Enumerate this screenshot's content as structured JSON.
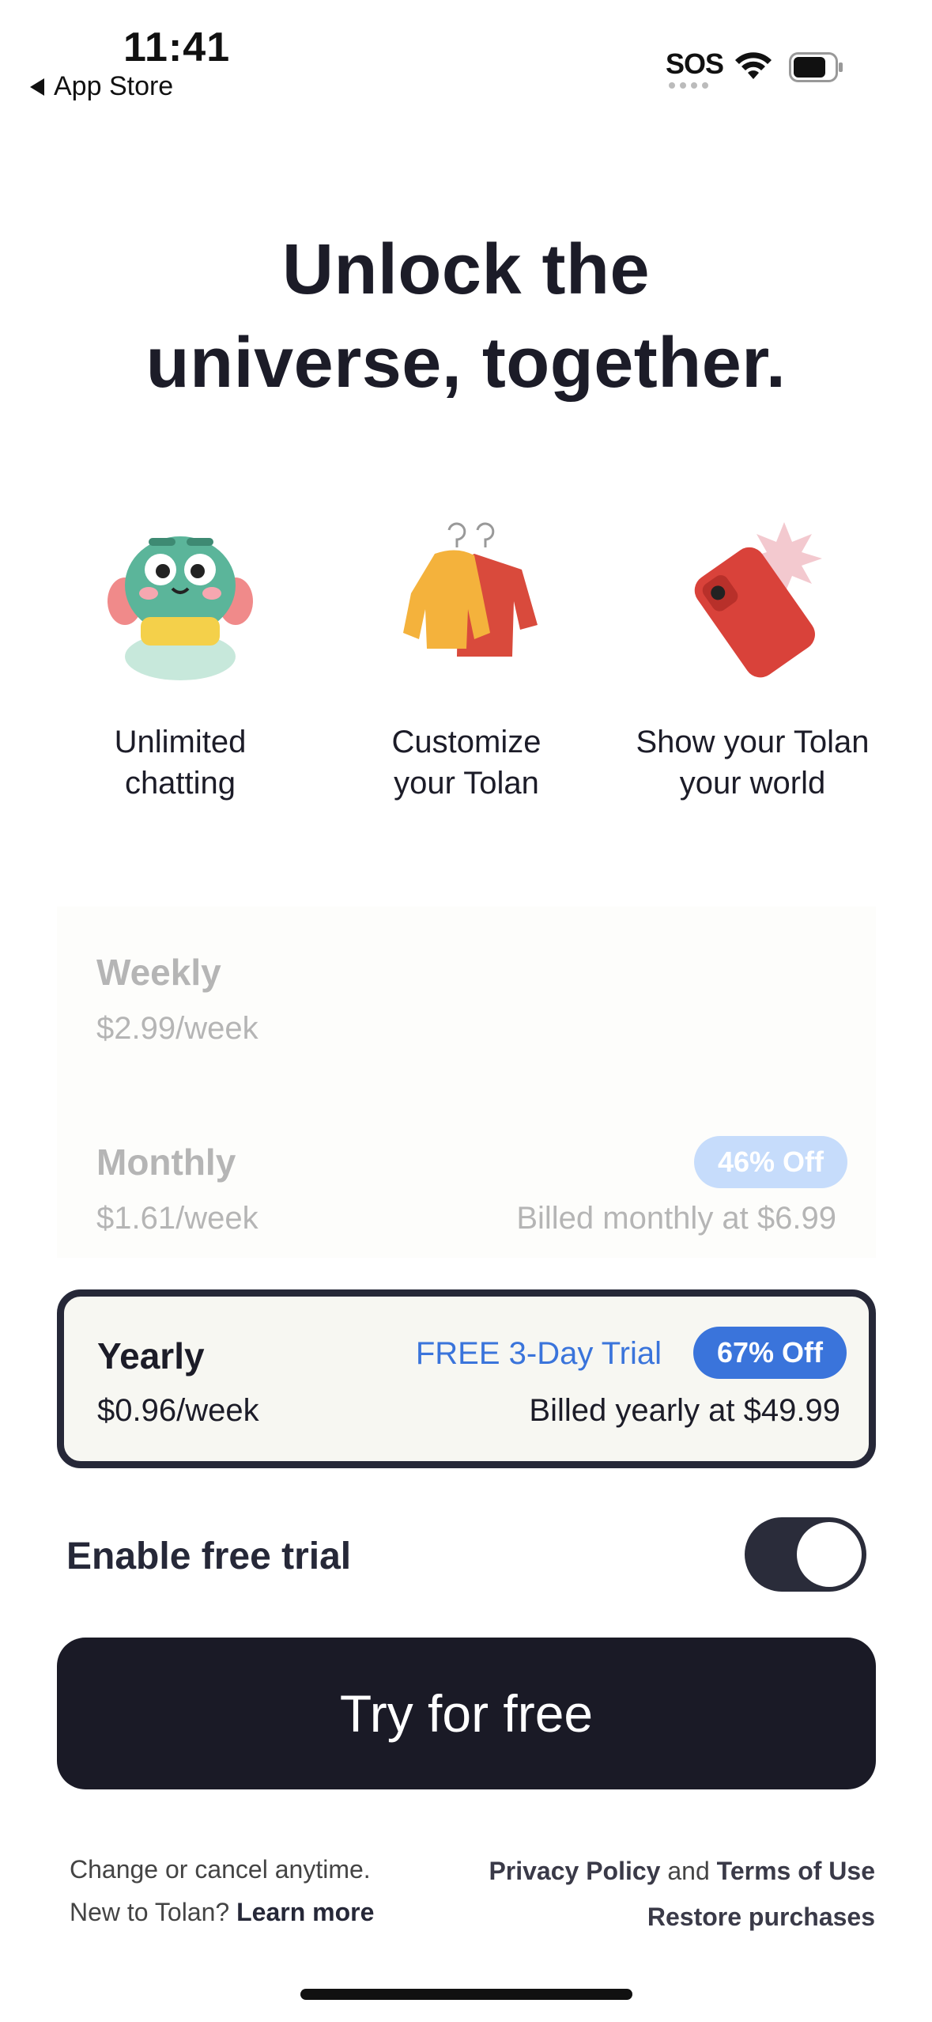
{
  "status_bar": {
    "time": "11:41",
    "back_label": "App Store",
    "sos": "SOS"
  },
  "headline": {
    "line1": "Unlock the",
    "line2": "universe, together."
  },
  "features": [
    {
      "line1": "Unlimited",
      "line2": "chatting",
      "icon": "tolan-character-icon"
    },
    {
      "line1": "Customize",
      "line2": "your Tolan",
      "icon": "clothes-hanger-icon"
    },
    {
      "line1": "Show your Tolan",
      "line2": "your world",
      "icon": "phone-camera-icon"
    }
  ],
  "plans": {
    "weekly": {
      "name": "Weekly",
      "price": "$2.99/week"
    },
    "monthly": {
      "name": "Monthly",
      "price": "$1.61/week",
      "badge": "46% Off",
      "billed": "Billed monthly at $6.99"
    },
    "yearly": {
      "name": "Yearly",
      "price": "$0.96/week",
      "trial": "FREE 3-Day Trial",
      "badge": "67% Off",
      "billed": "Billed yearly at $49.99",
      "selected": true
    }
  },
  "toggle": {
    "label": "Enable free trial",
    "on": true
  },
  "cta": {
    "label": "Try for free"
  },
  "footer": {
    "change_cancel": "Change or cancel anytime.",
    "new_to": "New to Tolan?",
    "learn_more": "Learn more",
    "privacy": "Privacy Policy",
    "and": "and",
    "terms": "Terms of Use",
    "restore": "Restore purchases"
  },
  "colors": {
    "accent_blue": "#3a74db",
    "dark": "#1a1a26",
    "faded_badge": "#c6dcfb"
  }
}
